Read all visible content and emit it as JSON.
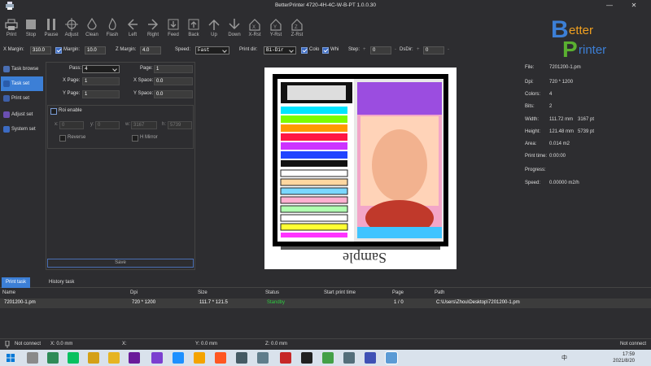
{
  "window": {
    "title": "BetterPrinter 4720-4H-4C-W-B-PT 1.0.0.30",
    "minimize": "—",
    "close": "✕"
  },
  "toolbar": {
    "buttons": [
      {
        "label": "Print",
        "icon": "printer-icon"
      },
      {
        "label": "Stop",
        "icon": "stop-icon"
      },
      {
        "label": "Pause",
        "icon": "pause-icon"
      },
      {
        "label": "Adjust",
        "icon": "crosshair-icon"
      },
      {
        "label": "Clean",
        "icon": "droplet-icon"
      },
      {
        "label": "Flash",
        "icon": "flame-icon"
      },
      {
        "label": "Left",
        "icon": "arrow-left-icon"
      },
      {
        "label": "Right",
        "icon": "arrow-right-icon"
      },
      {
        "label": "Feed",
        "icon": "feed-icon"
      },
      {
        "label": "Back",
        "icon": "back-icon"
      },
      {
        "label": "Up",
        "icon": "arrow-up-icon"
      },
      {
        "label": "Down",
        "icon": "arrow-down-icon"
      },
      {
        "label": "X-Rst",
        "icon": "home-x-icon"
      },
      {
        "label": "Y-Rst",
        "icon": "home-y-icon"
      },
      {
        "label": "Z-Rst",
        "icon": "home-z-icon"
      }
    ]
  },
  "logo": {
    "line1": "etter",
    "line2": "rinter",
    "letter_b": "B",
    "letter_p": "P"
  },
  "params": {
    "x_margin_label": "X Margin:",
    "x_margin": "310.0",
    "margin_label": "Margin:",
    "margin": "10.0",
    "z_margin_label": "Z Margin:",
    "z_margin": "4.0",
    "speed_label": "Speed:",
    "speed": "Fast",
    "print_dir_label": "Print dir:",
    "print_dir": "Bi-Dir",
    "color_label": "Colo",
    "white_label": "Whi",
    "step_label": "Step:",
    "step_plus": "+",
    "step_value": "0",
    "step_minus": "-",
    "dsdir_label": "DsDir:",
    "dsdir_plus": "+",
    "dsdir_value": "0",
    "dsdir_minus": "-"
  },
  "sidebar": {
    "items": [
      {
        "label": "Task browse"
      },
      {
        "label": "Task set"
      },
      {
        "label": "Print set"
      },
      {
        "label": "Adjust set"
      },
      {
        "label": "System set"
      }
    ]
  },
  "taskset": {
    "pass_label": "Pass:",
    "pass": "4",
    "page_label": "Page:",
    "page": "1",
    "xpage_label": "X Page:",
    "xpage": "1",
    "xspace_label": "X Space:",
    "xspace": "0.0",
    "ypage_label": "Y Page:",
    "ypage": "1",
    "yspace_label": "Y Space:",
    "yspace": "0.0",
    "roi_label": "Roi enable",
    "x_label": "x:",
    "x": "0",
    "y_label": "y:",
    "y": "0",
    "w_label": "w:",
    "w": "3167",
    "h_label": "h:",
    "h": "5739",
    "reverse_label": "Reverse",
    "hmirror_label": "H Mirror",
    "save_label": "Save"
  },
  "preview": {
    "sample_text": "Sample"
  },
  "info": {
    "file_label": "File:",
    "file": "7201200-1.pm",
    "dpi_label": "Dpi:",
    "dpi": "720 * 1200",
    "colors_label": "Colors:",
    "colors": "4",
    "bits_label": "Bits:",
    "bits": "2",
    "width_label": "Width:",
    "width_mm": "111.72 mm",
    "width_pt": "3167 pt",
    "height_label": "Height:",
    "height_mm": "121.48 mm",
    "height_pt": "5739 pt",
    "area_label": "Area:",
    "area": "0.014 m2",
    "print_time_label": "Print time:",
    "print_time": "0:00:00",
    "progress_label": "Progress:",
    "speed_label": "Speed:",
    "speed": "0.00000 m2/h"
  },
  "tabs": [
    {
      "label": "Print task"
    },
    {
      "label": "History task"
    }
  ],
  "table": {
    "headers": [
      "Name",
      "Dpi",
      "Size",
      "Status",
      "Start print time",
      "Page",
      "Path"
    ],
    "rows": [
      {
        "name": "7201200-1.pm",
        "dpi": "720 * 1200",
        "size": "111.7 * 121.5",
        "status": "Standby",
        "start": "",
        "page": "1 / 0",
        "path": "C:\\Users\\Zhou\\Desktop\\7201200-1.pm"
      }
    ]
  },
  "status": {
    "left": "Not connect",
    "x": "X: 0.0 mm",
    "xcolon": "X:",
    "y": "Y: 0.0 mm",
    "z": "Z: 0.0 mm",
    "right": "Not connect"
  },
  "taskbar": {
    "time": "17:59",
    "date": "2021/8/20",
    "lang": "中"
  },
  "colors": {
    "accent": "#3c7fd6",
    "standby": "#2ecc40",
    "bg": "#2d2d30"
  }
}
